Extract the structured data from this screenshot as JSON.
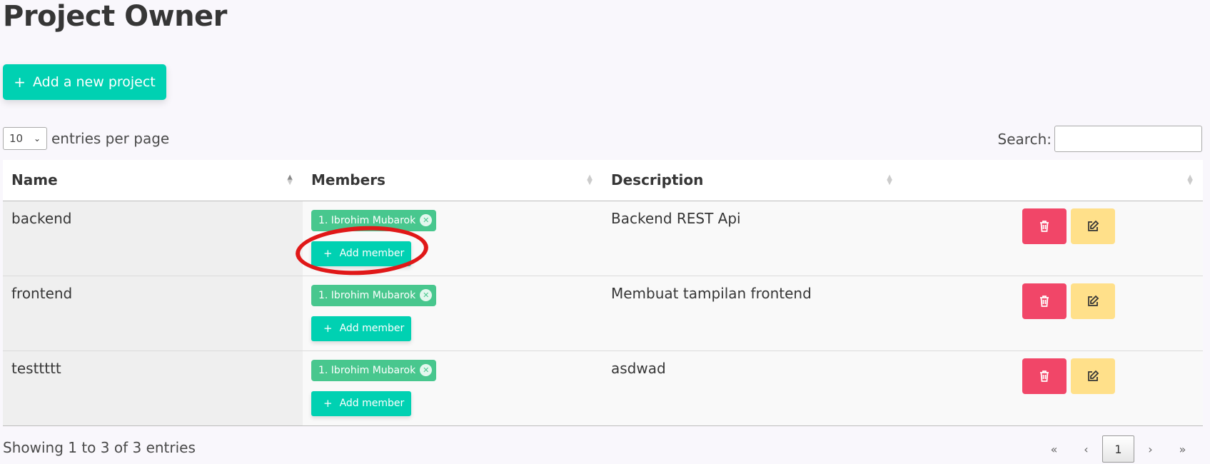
{
  "page": {
    "title": "Project Owner"
  },
  "toolbar": {
    "add_project_label": "Add a new project",
    "plus": "+"
  },
  "entries": {
    "selected": "10",
    "label": "entries per page"
  },
  "search": {
    "label": "Search:",
    "value": ""
  },
  "table": {
    "columns": [
      "Name",
      "Members",
      "Description",
      ""
    ],
    "rows": [
      {
        "name": "backend",
        "member": "1. Ibrohim Mubarok",
        "add_member_label": "Add member",
        "description": "Backend REST Api"
      },
      {
        "name": "frontend",
        "member": "1. Ibrohim Mubarok",
        "add_member_label": "Add member",
        "description": "Membuat tampilan frontend"
      },
      {
        "name": "testtttt",
        "member": "1. Ibrohim Mubarok",
        "add_member_label": "Add member",
        "description": "asdwad"
      }
    ]
  },
  "footer": {
    "info": "Showing 1 to 3 of 3 entries"
  },
  "pagination": {
    "first": "«",
    "prev": "‹",
    "current": "1",
    "next": "›",
    "last": "»"
  },
  "colors": {
    "primary": "#00d1b2",
    "tag": "#48c78e",
    "danger": "#f14668",
    "warning": "#ffe08a",
    "annotation": "#e01818"
  },
  "icons": {
    "delete": "trash-icon",
    "edit": "edit-icon",
    "tag_delete": "close-icon"
  }
}
